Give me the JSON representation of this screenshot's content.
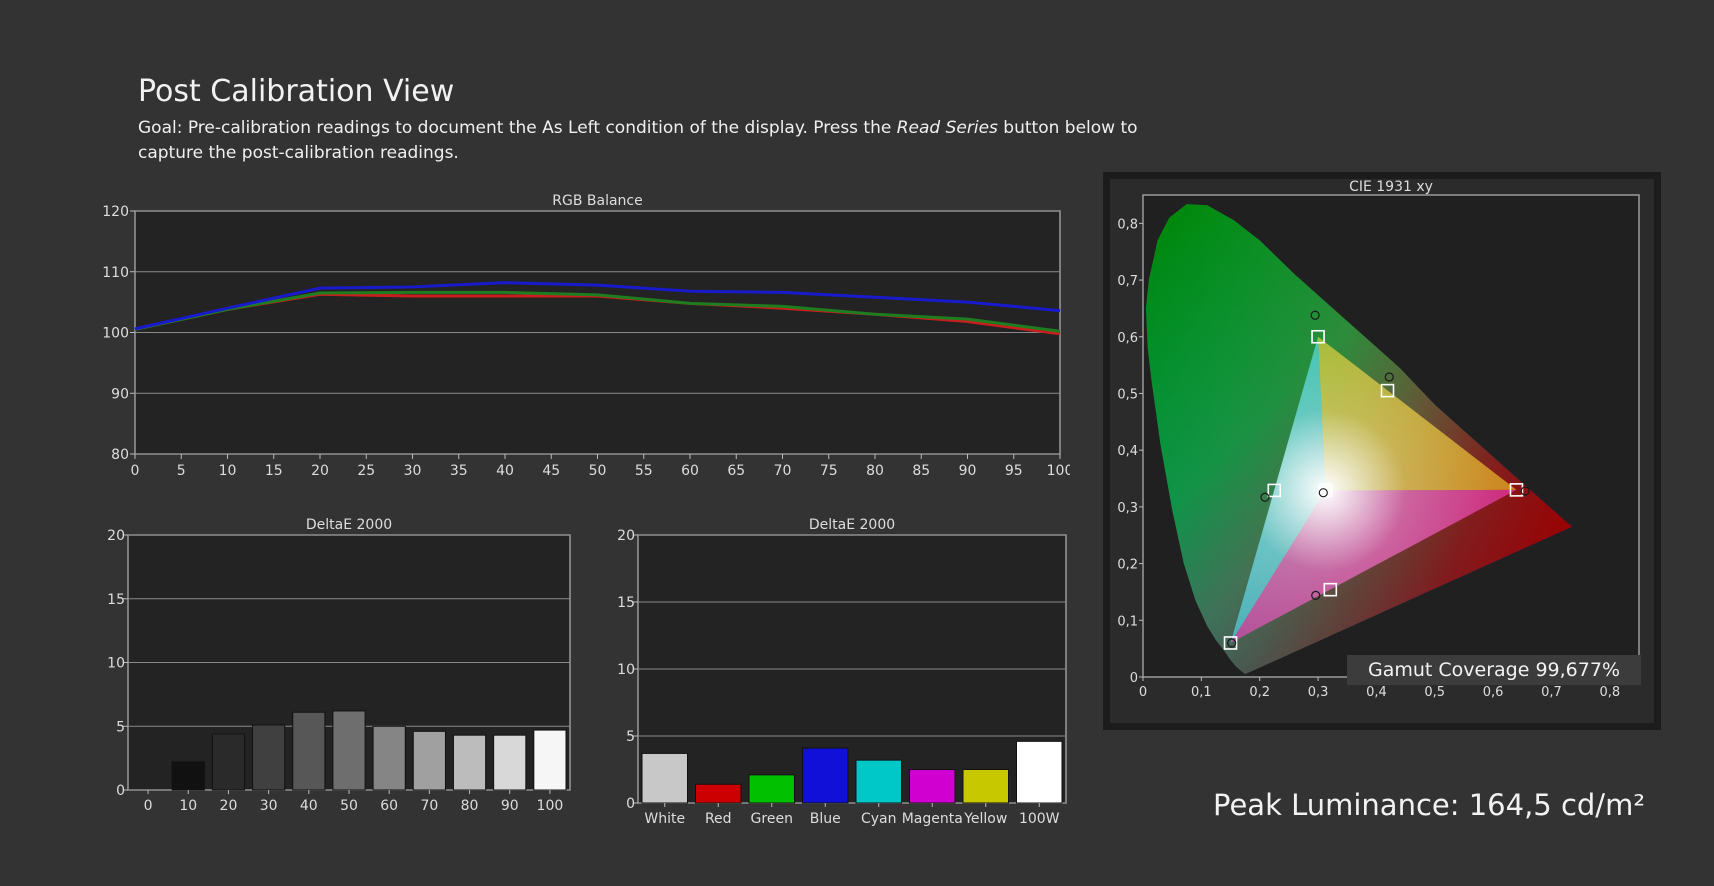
{
  "header": {
    "title": "Post Calibration View",
    "goal_prefix": "Goal: Pre-calibration readings to document the As Left condition of the display. Press the ",
    "goal_emphasis": "Read Series",
    "goal_suffix": " button below to capture the post-calibration readings."
  },
  "peak_luminance": "Peak Luminance: 164,5 cd/m²",
  "gamut_coverage": "Gamut Coverage 99,677%",
  "colors": {
    "background": "#333333",
    "plot_bg": "#232323",
    "red_series": "#c81e1e",
    "green_series": "#1e7d1e",
    "blue_series": "#1a1acd"
  },
  "chart_data": [
    {
      "id": "rgb_balance",
      "type": "line",
      "title": "RGB Balance",
      "xlabel": "",
      "ylabel": "",
      "ylim": [
        80,
        120
      ],
      "xlim": [
        0,
        100
      ],
      "y_ticks": [
        "80",
        "90",
        "100",
        "110",
        "120"
      ],
      "x_ticks": [
        "0",
        "5",
        "10",
        "15",
        "20",
        "25",
        "30",
        "35",
        "40",
        "45",
        "50",
        "55",
        "60",
        "65",
        "70",
        "75",
        "80",
        "85",
        "90",
        "95",
        "100"
      ],
      "grid": true,
      "x": [
        0,
        10,
        20,
        30,
        40,
        50,
        60,
        70,
        80,
        90,
        100
      ],
      "series": [
        {
          "color": "#c81e1e",
          "values": [
            100.5,
            103.8,
            106.3,
            106.0,
            106.0,
            106.0,
            104.8,
            104.0,
            103.0,
            101.8,
            99.8
          ]
        },
        {
          "color": "#1e7d1e",
          "values": [
            100.5,
            103.8,
            106.5,
            106.6,
            106.6,
            106.2,
            104.8,
            104.3,
            103.0,
            102.2,
            100.2
          ]
        },
        {
          "color": "#1a1acd",
          "values": [
            100.6,
            104.0,
            107.3,
            107.5,
            108.2,
            107.8,
            106.8,
            106.6,
            105.8,
            105.0,
            103.6
          ]
        }
      ]
    },
    {
      "id": "deltae_grayscale",
      "type": "bar",
      "title": "DeltaE 2000",
      "ylim": [
        0,
        20
      ],
      "y_ticks": [
        "0",
        "5",
        "10",
        "15",
        "20"
      ],
      "grid": true,
      "categories": [
        "0",
        "10",
        "20",
        "30",
        "40",
        "50",
        "60",
        "70",
        "80",
        "90",
        "100"
      ],
      "values": [
        0,
        2.2,
        4.4,
        5.1,
        6.1,
        6.2,
        5.0,
        4.6,
        4.3,
        4.3,
        4.7
      ],
      "bar_colors": [
        "#000000",
        "#111111",
        "#2a2a2a",
        "#404040",
        "#575757",
        "#6e6e6e",
        "#858585",
        "#a0a0a0",
        "#bcbcbc",
        "#d8d8d8",
        "#f6f6f6"
      ]
    },
    {
      "id": "deltae_colors",
      "type": "bar",
      "title": "DeltaE 2000",
      "ylim": [
        0,
        20
      ],
      "y_ticks": [
        "0",
        "5",
        "10",
        "15",
        "20"
      ],
      "grid": true,
      "categories": [
        "White",
        "Red",
        "Green",
        "Blue",
        "Cyan",
        "Magenta",
        "Yellow",
        "100W"
      ],
      "values": [
        3.7,
        1.4,
        2.1,
        4.1,
        3.2,
        2.5,
        2.5,
        4.6
      ],
      "bar_colors": [
        "#c8c8c8",
        "#cc0000",
        "#00c000",
        "#1010d8",
        "#00c8c8",
        "#d000d0",
        "#c8c800",
        "#ffffff"
      ]
    },
    {
      "id": "cie_1931",
      "type": "scatter",
      "title": "CIE 1931 xy",
      "xlim": [
        0,
        0.85
      ],
      "ylim": [
        0,
        0.85
      ],
      "x_ticks": [
        "0",
        "0,1",
        "0,2",
        "0,3",
        "0,4",
        "0,5",
        "0,6",
        "0,7",
        "0,8"
      ],
      "y_ticks": [
        "0",
        "0,1",
        "0,2",
        "0,3",
        "0,4",
        "0,5",
        "0,6",
        "0,7",
        "0,8"
      ],
      "targets": [
        {
          "name": "Red",
          "x": 0.64,
          "y": 0.33
        },
        {
          "name": "Green",
          "x": 0.3,
          "y": 0.6
        },
        {
          "name": "Blue",
          "x": 0.15,
          "y": 0.06
        },
        {
          "name": "Cyan",
          "x": 0.225,
          "y": 0.329
        },
        {
          "name": "Magenta",
          "x": 0.321,
          "y": 0.154
        },
        {
          "name": "Yellow",
          "x": 0.419,
          "y": 0.505
        },
        {
          "name": "White",
          "x": 0.3127,
          "y": 0.329
        }
      ],
      "measured": [
        {
          "name": "Red",
          "x": 0.655,
          "y": 0.328
        },
        {
          "name": "Green",
          "x": 0.295,
          "y": 0.638
        },
        {
          "name": "Blue",
          "x": 0.152,
          "y": 0.06
        },
        {
          "name": "Cyan",
          "x": 0.209,
          "y": 0.317
        },
        {
          "name": "Magenta",
          "x": 0.296,
          "y": 0.144
        },
        {
          "name": "Yellow",
          "x": 0.422,
          "y": 0.529
        },
        {
          "name": "White",
          "x": 0.309,
          "y": 0.325
        }
      ]
    }
  ]
}
